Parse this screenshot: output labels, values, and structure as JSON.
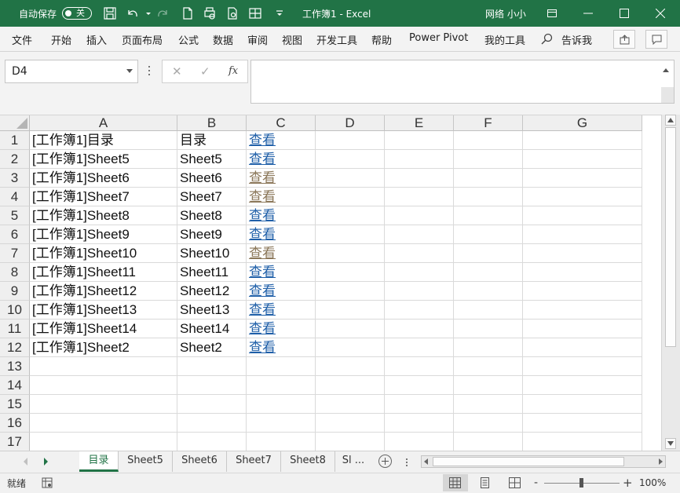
{
  "window": {
    "autosave_label": "自动保存",
    "autosave_state": "关",
    "title": "工作簿1 - Excel",
    "user": "网络 小小"
  },
  "ribbon": {
    "tabs": [
      "文件",
      "开始",
      "插入",
      "页面布局",
      "公式",
      "数据",
      "审阅",
      "视图",
      "开发工具",
      "帮助",
      "Power Pivot",
      "我的工具"
    ],
    "tell_me": "告诉我"
  },
  "formula_bar": {
    "name_box": "D4",
    "fx_label": "fx",
    "content": ""
  },
  "grid": {
    "columns": [
      "A",
      "B",
      "C",
      "D",
      "E",
      "F",
      "G"
    ],
    "rows": [
      "1",
      "2",
      "3",
      "4",
      "5",
      "6",
      "7",
      "8",
      "9",
      "10",
      "11",
      "12",
      "13",
      "14",
      "15",
      "16",
      "17"
    ],
    "cells": [
      {
        "a": "[工作簿1]目录",
        "b": "目录",
        "c": "查看",
        "c_style": "link"
      },
      {
        "a": "[工作簿1]Sheet5",
        "b": "Sheet5",
        "c": "查看",
        "c_style": "link"
      },
      {
        "a": "[工作簿1]Sheet6",
        "b": "Sheet6",
        "c": "查看",
        "c_style": "visited"
      },
      {
        "a": "[工作簿1]Sheet7",
        "b": "Sheet7",
        "c": "查看",
        "c_style": "visited"
      },
      {
        "a": "[工作簿1]Sheet8",
        "b": "Sheet8",
        "c": "查看",
        "c_style": "link"
      },
      {
        "a": "[工作簿1]Sheet9",
        "b": "Sheet9",
        "c": "查看",
        "c_style": "link"
      },
      {
        "a": "[工作簿1]Sheet10",
        "b": "Sheet10",
        "c": "查看",
        "c_style": "visited"
      },
      {
        "a": "[工作簿1]Sheet11",
        "b": "Sheet11",
        "c": "查看",
        "c_style": "link"
      },
      {
        "a": "[工作簿1]Sheet12",
        "b": "Sheet12",
        "c": "查看",
        "c_style": "link"
      },
      {
        "a": "[工作簿1]Sheet13",
        "b": "Sheet13",
        "c": "查看",
        "c_style": "link"
      },
      {
        "a": "[工作簿1]Sheet14",
        "b": "Sheet14",
        "c": "查看",
        "c_style": "link"
      },
      {
        "a": "[工作簿1]Sheet2",
        "b": "Sheet2",
        "c": "查看",
        "c_style": "link"
      }
    ]
  },
  "sheet_tabs": {
    "tabs": [
      "目录",
      "Sheet5",
      "Sheet6",
      "Sheet7",
      "Sheet8",
      "Sl ..."
    ],
    "active": "目录"
  },
  "status": {
    "ready": "就绪",
    "zoom": "100%",
    "zoom_minus": "-",
    "zoom_plus": "+"
  },
  "colors": {
    "title_bar": "#217346",
    "link": "#1f5fa8",
    "visited_link": "#8a7658"
  }
}
